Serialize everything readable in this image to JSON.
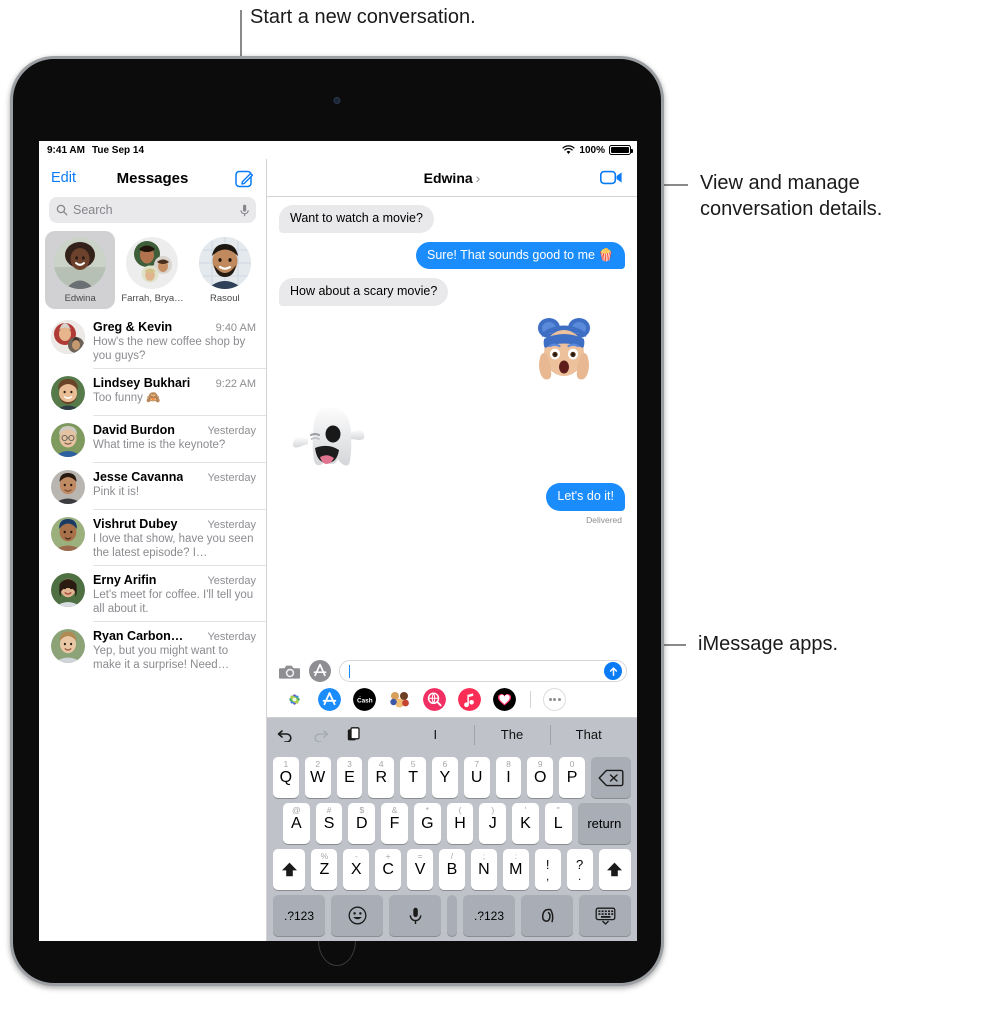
{
  "callouts": [
    {
      "id": "compose",
      "text": "Start a new conversation."
    },
    {
      "id": "details",
      "text": "View and manage\nconversation details."
    },
    {
      "id": "apps",
      "text": "iMessage apps."
    }
  ],
  "status_bar": {
    "time": "9:41 AM",
    "date": "Tue Sep 14",
    "battery_percent": "100%",
    "wifi_icon": "wifi-icon",
    "battery_icon": "battery-icon"
  },
  "sidebar": {
    "edit_label": "Edit",
    "title": "Messages",
    "compose_icon": "compose-icon",
    "search": {
      "placeholder": "Search",
      "icon": "search-icon",
      "mic_icon": "microphone-icon"
    },
    "pinned": [
      {
        "name": "Edwina",
        "selected": true
      },
      {
        "name": "Farrah, Brya…",
        "selected": false
      },
      {
        "name": "Rasoul",
        "selected": false
      }
    ],
    "conversations": [
      {
        "name": "Greg & Kevin",
        "time": "9:40 AM",
        "preview": "How's the new coffee shop by you guys?"
      },
      {
        "name": "Lindsey Bukhari",
        "time": "9:22 AM",
        "preview": "Too funny 🙈"
      },
      {
        "name": "David Burdon",
        "time": "Yesterday",
        "preview": "What time is the keynote?"
      },
      {
        "name": "Jesse Cavanna",
        "time": "Yesterday",
        "preview": "Pink it is!"
      },
      {
        "name": "Vishrut Dubey",
        "time": "Yesterday",
        "preview": "I love that show, have you seen the latest episode? I…"
      },
      {
        "name": "Erny Arifin",
        "time": "Yesterday",
        "preview": "Let's meet for coffee. I'll tell you all about it."
      },
      {
        "name": "Ryan Carbon…",
        "time": "Yesterday",
        "preview": "Yep, but you might want to make it a surprise! Need…"
      }
    ]
  },
  "conversation": {
    "title": "Edwina",
    "chevron": "›",
    "facetime_icon": "facetime-video-icon",
    "messages": [
      {
        "type": "text",
        "from": "them",
        "text": "Want to watch a movie?"
      },
      {
        "type": "text",
        "from": "me",
        "text": "Sure! That sounds good to me 🍿"
      },
      {
        "type": "text",
        "from": "them",
        "text": "How about a scary movie?"
      },
      {
        "type": "sticker",
        "from": "me",
        "sticker": "memoji-screaming-face-blue-hair"
      },
      {
        "type": "sticker",
        "from": "them",
        "sticker": "memoji-ghost"
      },
      {
        "type": "text",
        "from": "me",
        "text": "Let's do it!",
        "status": "Delivered"
      }
    ]
  },
  "input_bar": {
    "camera_icon": "camera-icon",
    "apps_icon": "app-store-icon",
    "text_value": "",
    "send_icon": "send-arrow-up-icon"
  },
  "app_drawer": {
    "apps": [
      {
        "name": "photos-app-icon",
        "color": "#ffffff"
      },
      {
        "name": "app-store-app-icon",
        "color": "#1b8cfc"
      },
      {
        "name": "apple-cash-app-icon",
        "color": "#000000",
        "label": "Cash"
      },
      {
        "name": "memoji-stickers-app-icon",
        "color": "#ffffff"
      },
      {
        "name": "images-search-app-icon",
        "color": "#f22f63"
      },
      {
        "name": "music-app-icon",
        "color": "#fa2d55"
      },
      {
        "name": "digital-touch-app-icon",
        "color": "#000000"
      }
    ],
    "more_icon": "more-dots-icon"
  },
  "keyboard": {
    "toolbar": {
      "undo_icon": "undo-icon",
      "redo_icon": "redo-icon",
      "paste_icon": "paste-icon"
    },
    "predictions": [
      "I",
      "The",
      "That"
    ],
    "row1": [
      {
        "main": "Q",
        "alt": "1"
      },
      {
        "main": "W",
        "alt": "2"
      },
      {
        "main": "E",
        "alt": "3"
      },
      {
        "main": "R",
        "alt": "4"
      },
      {
        "main": "T",
        "alt": "5"
      },
      {
        "main": "Y",
        "alt": "6"
      },
      {
        "main": "U",
        "alt": "7"
      },
      {
        "main": "I",
        "alt": "8"
      },
      {
        "main": "O",
        "alt": "9"
      },
      {
        "main": "P",
        "alt": "0"
      }
    ],
    "backspace_icon": "backspace-icon",
    "row2": [
      {
        "main": "A",
        "alt": "@"
      },
      {
        "main": "S",
        "alt": "#"
      },
      {
        "main": "D",
        "alt": "$"
      },
      {
        "main": "F",
        "alt": "&"
      },
      {
        "main": "G",
        "alt": "*"
      },
      {
        "main": "H",
        "alt": "("
      },
      {
        "main": "J",
        "alt": ")"
      },
      {
        "main": "K",
        "alt": "'"
      },
      {
        "main": "L",
        "alt": "\""
      }
    ],
    "return_label": "return",
    "row3": [
      {
        "main": "Z",
        "alt": "%"
      },
      {
        "main": "X",
        "alt": "-"
      },
      {
        "main": "C",
        "alt": "+"
      },
      {
        "main": "V",
        "alt": "="
      },
      {
        "main": "B",
        "alt": "/"
      },
      {
        "main": "N",
        "alt": ";"
      },
      {
        "main": "M",
        "alt": ":"
      }
    ],
    "punct_keys": [
      {
        "top": "!",
        "bottom": ","
      },
      {
        "top": "?",
        "bottom": "."
      }
    ],
    "shift_icon": "shift-arrow-icon",
    "row4": {
      "numbers_left": ".?123",
      "emoji_icon": "emoji-smiley-icon",
      "dictation_icon": "microphone-icon",
      "space": "",
      "numbers_right": ".?123",
      "handwriting_icon": "handwriting-icon",
      "dismiss_icon": "dismiss-keyboard-icon"
    }
  },
  "colors": {
    "accent_blue": "#0a7bf5",
    "bubble_blue": "#1b8cfc",
    "bubble_gray": "#e9e9eb",
    "keyboard_bg": "#bfc3c9"
  }
}
